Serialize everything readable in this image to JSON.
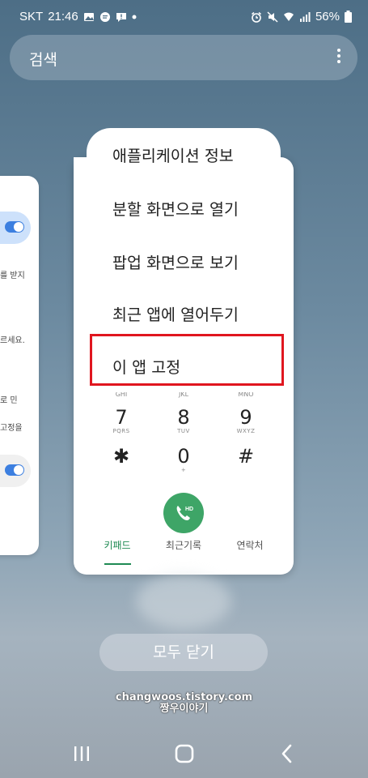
{
  "status": {
    "carrier": "SKT",
    "time": "21:46",
    "battery": "56%"
  },
  "search": {
    "label": "검색"
  },
  "left_card": {
    "snippets": [
      "를 받지",
      "르세요.",
      "로 민",
      "고정을"
    ]
  },
  "context_menu": {
    "items": [
      "애플리케이션 정보",
      "분할 화면으로 열기",
      "팝업 화면으로 보기",
      "최근 앱에 열어두기",
      "이 앱 고정"
    ]
  },
  "dialer": {
    "letters_row": [
      "GHI",
      "JKL",
      "MNO"
    ],
    "keys": [
      {
        "num": "7",
        "sub": "PQRS"
      },
      {
        "num": "8",
        "sub": "TUV"
      },
      {
        "num": "9",
        "sub": "WXYZ"
      },
      {
        "num": "✱",
        "sub": ""
      },
      {
        "num": "0",
        "sub": "+"
      },
      {
        "num": "#",
        "sub": ""
      }
    ],
    "call_badge": "HD",
    "tabs": [
      "키패드",
      "최근기록",
      "연락처"
    ]
  },
  "close_all_label": "모두 닫기",
  "watermark": {
    "line1": "changwoos.tistory.com",
    "line2": "짱우이야기"
  },
  "colors": {
    "highlight": "#e0161f",
    "call_green": "#3ea567",
    "active_tab": "#1f8a53",
    "toggle_blue": "#3c7fe0"
  }
}
